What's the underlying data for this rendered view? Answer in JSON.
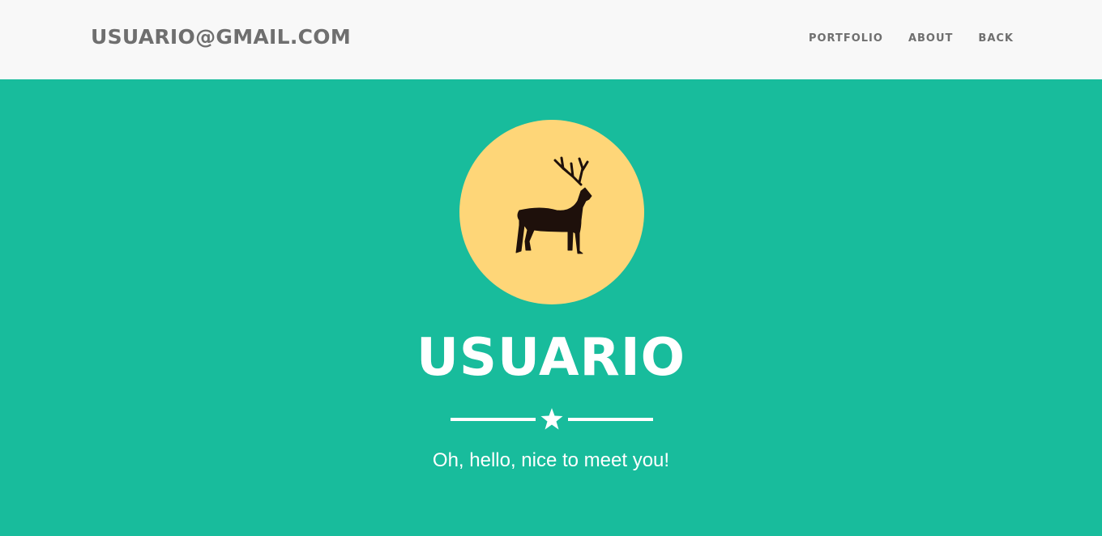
{
  "navbar": {
    "brand": "USUARIO@GMAIL.COM",
    "links": [
      "PORTFOLIO",
      "ABOUT",
      "BACK"
    ]
  },
  "hero": {
    "avatar_icon": "elk-icon",
    "name": "USUARIO",
    "divider_icon": "star-icon",
    "tagline": "Oh, hello, nice to meet you!"
  },
  "colors": {
    "navbar_bg": "#f8f8f8",
    "nav_text": "#6f6f6f",
    "hero_bg": "#18bc9c",
    "avatar_bg": "#fed678",
    "elk_fill": "#1e100b",
    "hero_text": "#ffffff"
  }
}
